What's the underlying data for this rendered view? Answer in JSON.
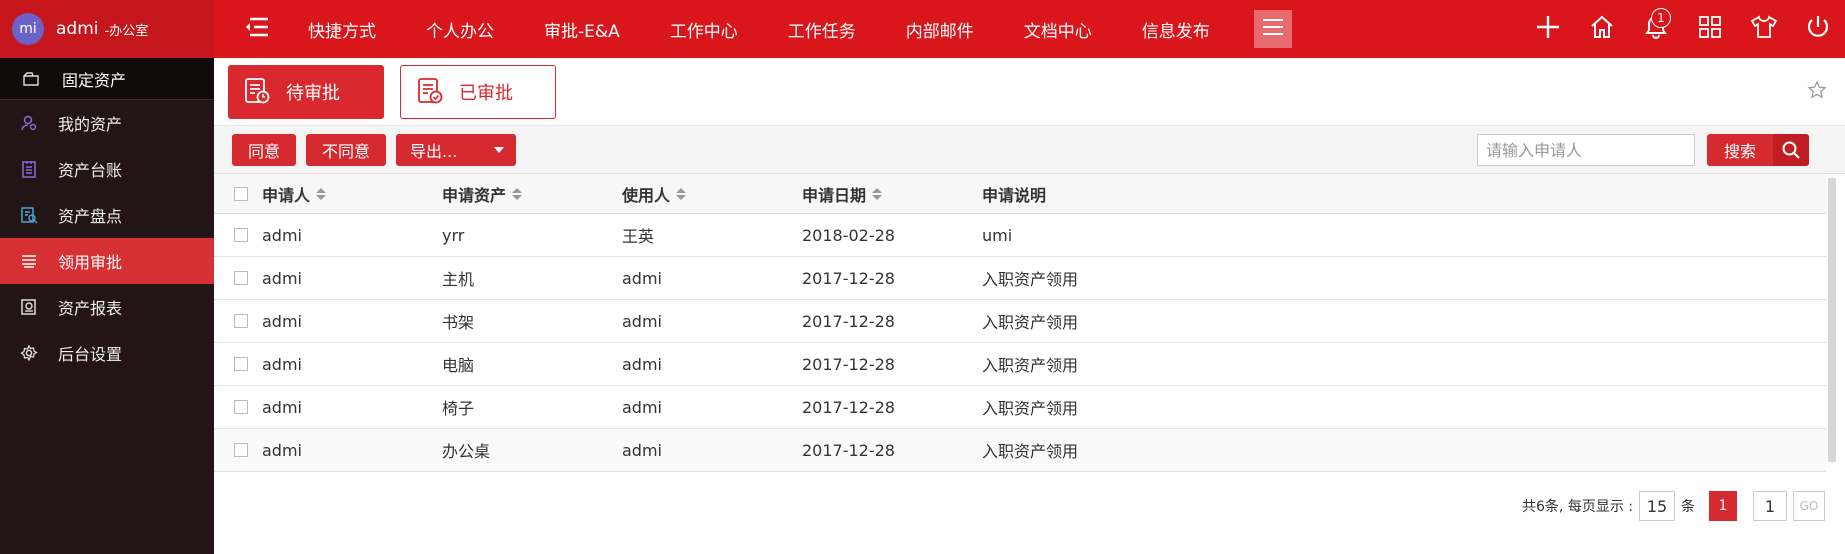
{
  "brand": {
    "avatar": "mi",
    "user": "admi",
    "org": "-办公室"
  },
  "sidebar": {
    "header": {
      "label": "固定资产",
      "icon": "asset-folder-icon"
    },
    "items": [
      {
        "label": "我的资产",
        "icon": "user-asset-icon"
      },
      {
        "label": "资产台账",
        "icon": "ledger-icon"
      },
      {
        "label": "资产盘点",
        "icon": "inventory-icon"
      },
      {
        "label": "领用审批",
        "icon": "approval-icon",
        "active": true
      },
      {
        "label": "资产报表",
        "icon": "report-icon"
      },
      {
        "label": "后台设置",
        "icon": "gear-icon"
      }
    ]
  },
  "topbar": {
    "nav": [
      "快捷方式",
      "个人办公",
      "审批-E&A",
      "工作中心",
      "工作任务",
      "内部邮件",
      "文档中心",
      "信息发布"
    ],
    "notification_count": "1",
    "icons": [
      "plus-icon",
      "home-icon",
      "bell-icon",
      "apps-icon",
      "shirt-icon",
      "power-icon"
    ]
  },
  "tabs": {
    "pending": "待审批",
    "approved": "已审批"
  },
  "toolbar": {
    "agree": "同意",
    "disagree": "不同意",
    "export": "导出...",
    "search_placeholder": "请输入申请人",
    "search": "搜索"
  },
  "table": {
    "headers": [
      "申请人",
      "申请资产",
      "使用人",
      "申请日期",
      "申请说明"
    ],
    "rows": [
      [
        "admi",
        "yrr",
        "王英",
        "2018-02-28",
        "umi"
      ],
      [
        "admi",
        "主机",
        "admi",
        "2017-12-28",
        "入职资产领用"
      ],
      [
        "admi",
        "书架",
        "admi",
        "2017-12-28",
        "入职资产领用"
      ],
      [
        "admi",
        "电脑",
        "admi",
        "2017-12-28",
        "入职资产领用"
      ],
      [
        "admi",
        "椅子",
        "admi",
        "2017-12-28",
        "入职资产领用"
      ],
      [
        "admi",
        "办公桌",
        "admi",
        "2017-12-28",
        "入职资产领用"
      ]
    ]
  },
  "pager": {
    "summary": "共6条, 每页显示 :",
    "page_size": "15",
    "unit": "条",
    "current": "1",
    "goto_value": "1",
    "go": "GO"
  },
  "colors": {
    "primary": "#d9161c",
    "sidebar_bg": "#231415",
    "active": "#d62f34"
  }
}
